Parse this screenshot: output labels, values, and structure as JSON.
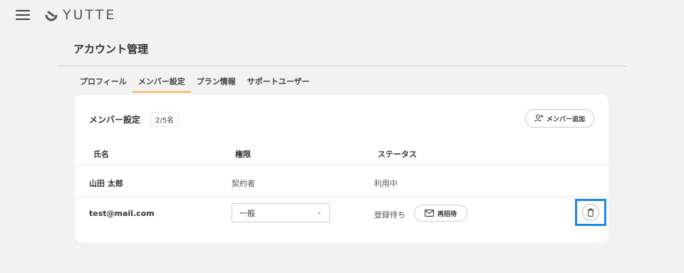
{
  "app": {
    "logo_text": "YUTTE"
  },
  "page": {
    "title": "アカウント管理"
  },
  "tabs": [
    {
      "label": "プロフィール"
    },
    {
      "label": "メンバー設定"
    },
    {
      "label": "プラン情報"
    },
    {
      "label": "サポートユーザー"
    }
  ],
  "members": {
    "title": "メンバー設定",
    "count": "2/5名",
    "add_button": "メンバー追加",
    "columns": [
      "氏名",
      "権限",
      "ステータス"
    ],
    "rows": [
      {
        "name": "山田 太郎",
        "role": "契約者",
        "status": "利用中"
      },
      {
        "name": "test@mail.com",
        "role": "一般",
        "status": "登録待ち",
        "action": "再招待"
      }
    ]
  },
  "colors": {
    "accent": "#f2b44a",
    "focus": "#1e88e5"
  }
}
